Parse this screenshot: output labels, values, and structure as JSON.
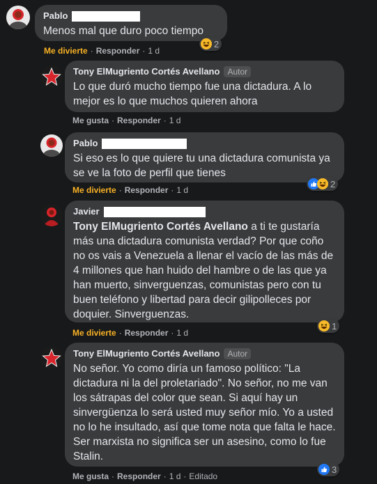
{
  "comments": [
    {
      "name": "Pablo",
      "text": "Menos mal que duro poco tiempo",
      "primary_action": "Me divierte",
      "reply": "Responder",
      "time": "1 d",
      "reactions": [
        "laugh"
      ],
      "reaction_count": "2"
    },
    {
      "name": "Tony ElMugriento Cortés Avellano",
      "badge": "Autor",
      "text": "Lo que duró mucho tiempo fue una dictadura. A lo mejor es lo que muchos quieren ahora",
      "primary_action": "Me gusta",
      "reply": "Responder",
      "time": "1 d"
    },
    {
      "name": "Pablo",
      "text": "Si eso es lo que quiere tu una dictadura comunista ya se ve la foto de perfil que tienes",
      "primary_action": "Me divierte",
      "reply": "Responder",
      "time": "1 d",
      "reactions": [
        "like",
        "laugh"
      ],
      "reaction_count": "2"
    },
    {
      "name": "Javier",
      "mention": "Tony ElMugriento Cortés Avellano",
      "text": " a ti te gustaría más una dictadura comunista verdad? Por que coño no os vais a Venezuela a llenar el vacío de las más de 4 millones que han huido del hambre o de las que ya han muerto, sinverguenzas, comunistas pero con tu buen teléfono y libertad para decir gilipolleces por doquier. Sinverguenzas.",
      "primary_action": "Me divierte",
      "reply": "Responder",
      "time": "1 d",
      "reactions": [
        "laugh"
      ],
      "reaction_count": "1"
    },
    {
      "name": "Tony ElMugriento Cortés Avellano",
      "badge": "Autor",
      "text": "No señor. Yo como diría un famoso político: \"La dictadura ni la del proletariado\". No señor, no me van los sátrapas del color que sean. Si aquí hay un sinvergüenza lo será usted muy señor mío. Yo a usted no lo he insultado, así que tome nota que falta le hace. Ser marxista no significa ser un asesino, como lo fue Stalin.",
      "primary_action": "Me gusta",
      "reply": "Responder",
      "time": "1 d",
      "edited": "Editado",
      "reactions": [
        "like"
      ],
      "reaction_count": "3"
    }
  ],
  "colors": {
    "background": "#18191a",
    "bubble": "#3a3b3c",
    "text": "#e4e6eb",
    "secondary": "#b0b3b8",
    "laugh_action": "#f7b125",
    "like": "#2078f4"
  }
}
